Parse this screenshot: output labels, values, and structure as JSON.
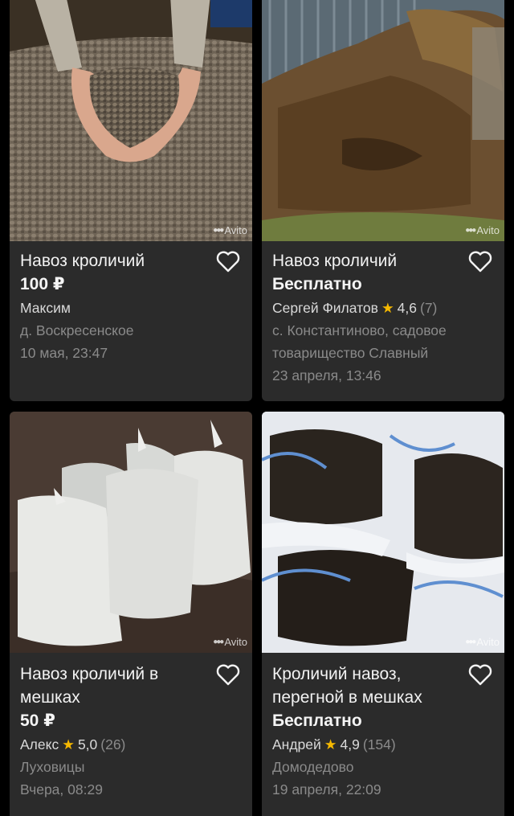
{
  "watermark": "Avito",
  "colors": {
    "card_bg": "#2b2b2b",
    "star": "#f5b800",
    "muted": "#8a8a8a"
  },
  "listings": [
    {
      "title": "Навоз кроличий",
      "price": "100 ₽",
      "seller": "Максим",
      "location": "д. Воскресенское",
      "date": "10 мая, 23:47",
      "image": "hands-holding-rabbit-pellets"
    },
    {
      "title": "Навоз кроличий",
      "price": "Бесплатно",
      "seller": "Сергей Филатов",
      "rating": "4,6",
      "reviews": "(7)",
      "location": "с. Константиново, садовое товарищество Славный",
      "date": "23 апреля, 13:46",
      "image": "manure-pile"
    },
    {
      "title": "Навоз кроличий в мешках",
      "price": "50 ₽",
      "seller": "Алекс",
      "rating": "5,0",
      "reviews": "(26)",
      "location": "Луховицы",
      "date": "Вчера, 08:29",
      "image": "white-sacks"
    },
    {
      "title": "Кроличий навоз, перегной в мешках",
      "price": "Бесплатно",
      "seller": "Андрей",
      "rating": "4,9",
      "reviews": "(154)",
      "location": "Домодедово",
      "date": "19 апреля, 22:09",
      "image": "open-sacks-humus"
    }
  ]
}
